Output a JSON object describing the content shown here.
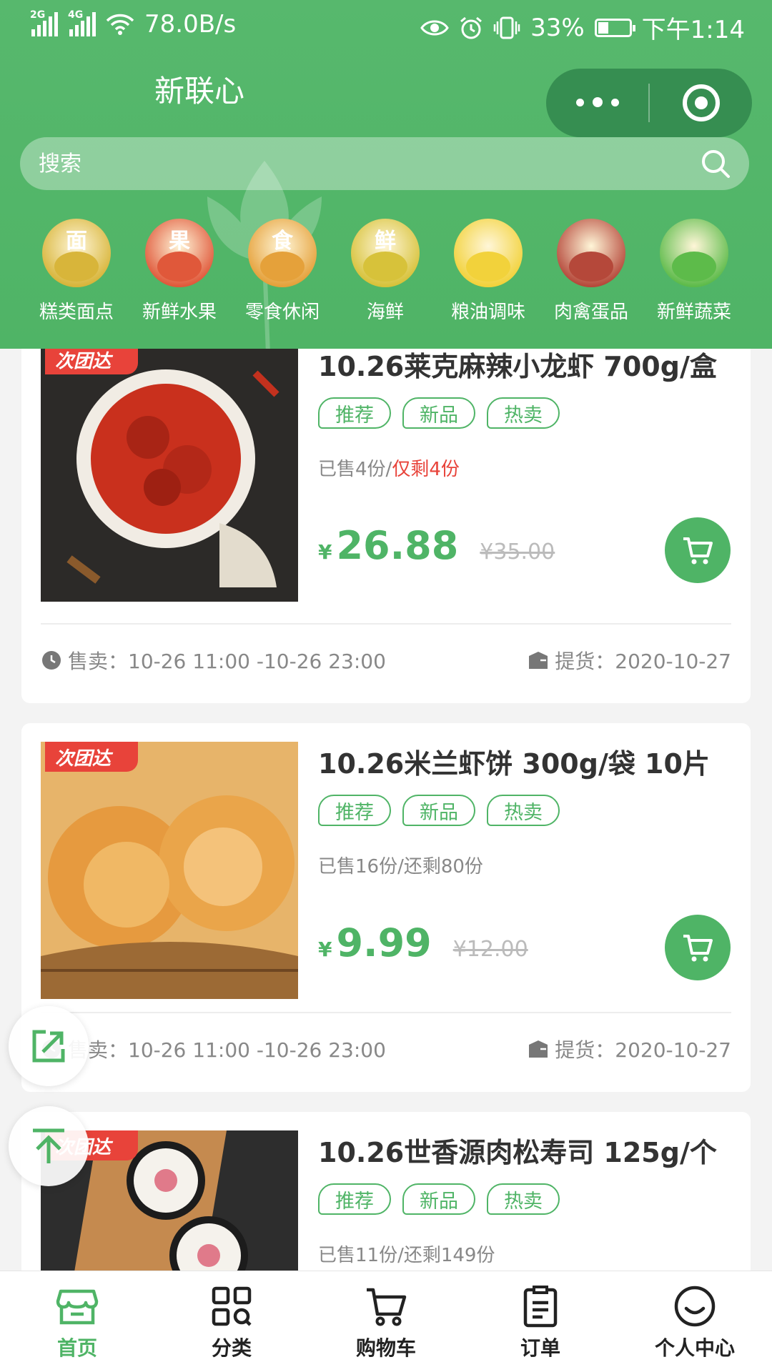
{
  "status_bar": {
    "signal_1": "2G",
    "signal_2": "4G",
    "speed": "78.0B/s",
    "battery": "33%",
    "battery_level": 0.33,
    "time": "下午1:14"
  },
  "header": {
    "title": "新联心",
    "search_placeholder": "搜索"
  },
  "categories": [
    {
      "label": "糕类面点",
      "glyph": "面",
      "color": "#d8b53a"
    },
    {
      "label": "新鲜水果",
      "glyph": "果",
      "color": "#e0583a"
    },
    {
      "label": "零食休闲",
      "glyph": "食",
      "color": "#e5a13a"
    },
    {
      "label": "海鲜",
      "glyph": "鲜",
      "color": "#d7c23a"
    },
    {
      "label": "粮油调味",
      "glyph": "",
      "color": "#f2d23b"
    },
    {
      "label": "肉禽蛋品",
      "glyph": "",
      "color": "#b5483a"
    },
    {
      "label": "新鲜蔬菜",
      "glyph": "",
      "color": "#5dbb4a"
    }
  ],
  "products": [
    {
      "badge": "次团达",
      "name": "10.26莱克麻辣小龙虾 700g/盒",
      "tags": [
        "推荐",
        "新品",
        "热卖"
      ],
      "sold": "已售4份/",
      "remaining": "仅剩4份",
      "currency": "¥",
      "price": "26.88",
      "original_price": "¥35.00",
      "sale_time": "售卖：10-26 11:00 -10-26 23:00",
      "pickup": "提货：2020-10-27"
    },
    {
      "badge": "次团达",
      "name": "10.26米兰虾饼 300g/袋 10片",
      "tags": [
        "推荐",
        "新品",
        "热卖"
      ],
      "sold": "已售16份/还剩80份",
      "remaining": "",
      "currency": "¥",
      "price": "9.99",
      "original_price": "¥12.00",
      "sale_time": "售卖：10-26 11:00 -10-26 23:00",
      "pickup": "提货：2020-10-27"
    },
    {
      "badge": "次团达",
      "name": "10.26世香源肉松寿司 125g/个",
      "tags": [
        "推荐",
        "新品",
        "热卖"
      ],
      "sold": "已售11份/还剩149份",
      "remaining": ""
    }
  ],
  "tabs": [
    {
      "label": "首页",
      "icon": "home-store-icon",
      "active": true
    },
    {
      "label": "分类",
      "icon": "grid-icon",
      "active": false
    },
    {
      "label": "购物车",
      "icon": "cart-icon",
      "active": false
    },
    {
      "label": "订单",
      "icon": "clipboard-icon",
      "active": false
    },
    {
      "label": "个人中心",
      "icon": "smile-icon",
      "active": false
    }
  ],
  "colors": {
    "brand": "#4fb466",
    "warning": "#e8433a"
  }
}
